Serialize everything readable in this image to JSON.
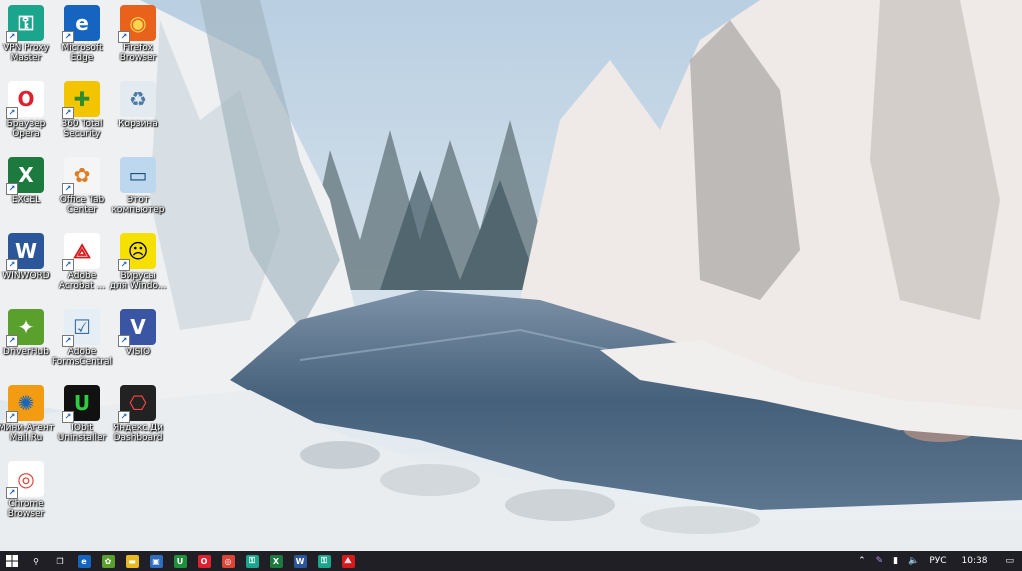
{
  "desktop": {
    "icons": [
      {
        "name": "vpn-proxy-master-icon",
        "label": "VPN Proxy\nMaster",
        "bg": "#1aa58c",
        "fg": "#ffffff",
        "glyph": "⚿",
        "shortcut": true
      },
      {
        "name": "microsoft-edge-icon",
        "label": "Microsoft\nEdge",
        "bg": "#1565c0",
        "fg": "#ffffff",
        "glyph": "e",
        "shortcut": true
      },
      {
        "name": "firefox-icon",
        "label": "Firefox\nBrowser",
        "bg": "#e8621c",
        "fg": "#ffd54f",
        "glyph": "◉",
        "shortcut": true
      },
      {
        "name": "opera-icon",
        "label": "Браузер\nOpera",
        "bg": "#ffffff",
        "fg": "#e0202e",
        "glyph": "O",
        "shortcut": true
      },
      {
        "name": "360-total-security-icon",
        "label": "360 Total\nSecurity",
        "bg": "#f2c500",
        "fg": "#2e8b2e",
        "glyph": "✚",
        "shortcut": true
      },
      {
        "name": "recycle-bin-icon",
        "label": "Корзина",
        "bg": "#e3eaf0",
        "fg": "#4a7aa5",
        "glyph": "♻",
        "shortcut": false
      },
      {
        "name": "excel-icon",
        "label": "EXCEL",
        "bg": "#1d7a3e",
        "fg": "#ffffff",
        "glyph": "X",
        "shortcut": true
      },
      {
        "name": "office-tab-center-icon",
        "label": "Office Tab\nCenter",
        "bg": "#f5f5f5",
        "fg": "#e07b1f",
        "glyph": "✿",
        "shortcut": true
      },
      {
        "name": "this-computer-icon",
        "label": "Этот\nкомпьютер",
        "bg": "#bcd7ee",
        "fg": "#1e4f7a",
        "glyph": "▭",
        "shortcut": false
      },
      {
        "name": "winword-icon",
        "label": "WINWORD",
        "bg": "#2b579a",
        "fg": "#ffffff",
        "glyph": "W",
        "shortcut": true
      },
      {
        "name": "adobe-acrobat-icon",
        "label": "Adobe\nAcrobat ...",
        "bg": "#ffffff",
        "fg": "#d7191c",
        "glyph": "⟁",
        "shortcut": true
      },
      {
        "name": "windows-viruses-icon",
        "label": "Вирусы\nдля Windo...",
        "bg": "#f5e000",
        "fg": "#000000",
        "glyph": "☹",
        "shortcut": true
      },
      {
        "name": "driverhub-icon",
        "label": "DriverHub",
        "bg": "#5aa02c",
        "fg": "#ffffff",
        "glyph": "✦",
        "shortcut": true
      },
      {
        "name": "adobe-formscentral-icon",
        "label": "Adobe\nFormsCentral",
        "bg": "#e6eef5",
        "fg": "#3a6ea5",
        "glyph": "☑",
        "shortcut": true
      },
      {
        "name": "visio-icon",
        "label": "VISIO",
        "bg": "#3955a3",
        "fg": "#ffffff",
        "glyph": "V",
        "shortcut": true
      },
      {
        "name": "mail-ru-agent-icon",
        "label": "Мини-Агент\nMail.Ru",
        "bg": "#f39c12",
        "fg": "#1565c0",
        "glyph": "✺",
        "shortcut": true
      },
      {
        "name": "iobit-uninstaller-icon",
        "label": "IObit\nUninstaller",
        "bg": "#111111",
        "fg": "#2ecc40",
        "glyph": "U",
        "shortcut": true
      },
      {
        "name": "yandex-dashboard-icon",
        "label": "Яндекс.Ди\nDashboard",
        "bg": "#222222",
        "fg": "#ff4444",
        "glyph": "⎔",
        "shortcut": true
      },
      {
        "name": "chrome-icon",
        "label": "Chrome\nBrowser",
        "bg": "#ffffff",
        "fg": "#db4437",
        "glyph": "◎",
        "shortcut": true
      }
    ]
  },
  "taskbar": {
    "start_icon": "windows-start-icon",
    "items": [
      {
        "name": "search-icon",
        "glyph": "⚲",
        "bg": "transparent"
      },
      {
        "name": "task-view-icon",
        "glyph": "❐",
        "bg": "transparent"
      },
      {
        "name": "taskbar-edge-icon",
        "glyph": "e",
        "bg": "#1565c0"
      },
      {
        "name": "taskbar-office-tab-icon",
        "glyph": "✿",
        "bg": "#5aa02c"
      },
      {
        "name": "taskbar-file-explorer-icon",
        "glyph": "▬",
        "bg": "#e8b923"
      },
      {
        "name": "taskbar-store-icon",
        "glyph": "▣",
        "bg": "#2d6cc0"
      },
      {
        "name": "taskbar-iobit-icon",
        "glyph": "U",
        "bg": "#1e8f3a"
      },
      {
        "name": "taskbar-opera-icon",
        "glyph": "O",
        "bg": "#e0202e"
      },
      {
        "name": "taskbar-chrome-icon",
        "glyph": "◎",
        "bg": "#db4437"
      },
      {
        "name": "taskbar-vpn-icon",
        "glyph": "⚿",
        "bg": "#1aa58c"
      },
      {
        "name": "taskbar-excel-icon",
        "glyph": "X",
        "bg": "#1d7a3e"
      },
      {
        "name": "taskbar-word-icon",
        "glyph": "W",
        "bg": "#2b579a"
      },
      {
        "name": "taskbar-vpn2-icon",
        "glyph": "⚿",
        "bg": "#1aa58c"
      },
      {
        "name": "taskbar-acrobat-icon",
        "glyph": "⟁",
        "bg": "#d7191c"
      }
    ],
    "tray": {
      "chevron": "⌃",
      "pen": "✎",
      "network": "▮",
      "volume": "🔈",
      "language": "РУС",
      "time": "10:38",
      "notification": "▭"
    }
  }
}
